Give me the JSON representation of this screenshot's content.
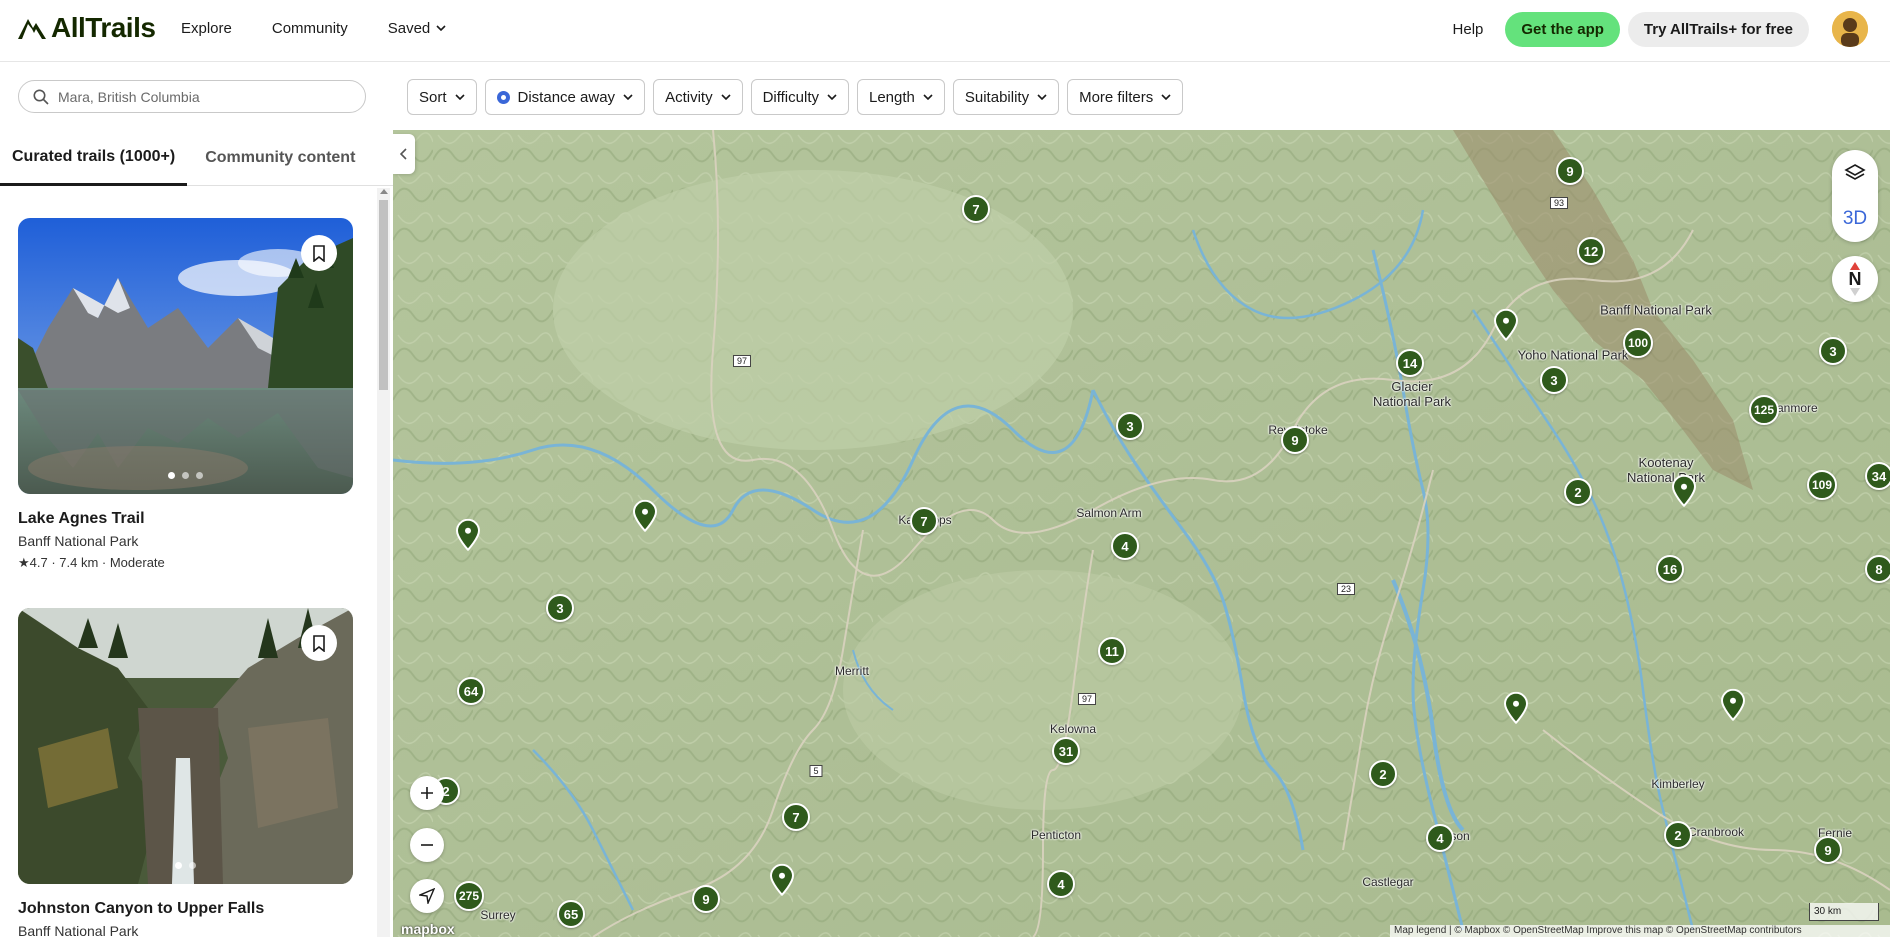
{
  "header": {
    "logo_text": "AllTrails",
    "nav": [
      "Explore",
      "Community",
      "Saved"
    ],
    "help": "Help",
    "get_app": "Get the app",
    "try_plus": "Try AllTrails+ for free"
  },
  "search": {
    "placeholder": "Mara, British Columbia"
  },
  "filters": [
    "Sort",
    "Distance away",
    "Activity",
    "Difficulty",
    "Length",
    "Suitability",
    "More filters"
  ],
  "tabs": {
    "curated": "Curated trails (1000+)",
    "community": "Community content"
  },
  "trails": [
    {
      "title": "Lake Agnes Trail",
      "park": "Banff National Park",
      "rating": "4.7",
      "meta": " · 7.4 km · Moderate",
      "star": "★"
    },
    {
      "title": "Johnston Canyon to Upper Falls",
      "park": "Banff National Park"
    }
  ],
  "map": {
    "btn_3d": "3D",
    "compass": "N",
    "scale": "30 km",
    "mapbox": "mapbox",
    "attribution": "Map legend | © Mapbox © OpenStreetMap  Improve this map © OpenStreetMap contributors",
    "places": {
      "kamloops": "Kamloops",
      "salmon_arm": "Salmon Arm",
      "revelstoke": "Revelstoke",
      "merritt": "Merritt",
      "kelowna": "Kelowna",
      "penticton": "Penticton",
      "castlegar": "Castlegar",
      "kimberley": "Kimberley",
      "cranbrook": "Cranbrook",
      "fernie": "Fernie",
      "surrey": "Surrey",
      "nelson": "Nelson",
      "canmore": "Canmore"
    },
    "parks": {
      "banff": "Banff National Park",
      "yoho": "Yoho National Park",
      "glacier": "Glacier\nNational Park",
      "kootenay": "Kootenay\nNational Park"
    },
    "highways": {
      "h97a": "97",
      "h93": "93",
      "h23": "23",
      "h97b": "97",
      "h5": "5"
    },
    "clusters": [
      "9",
      "12",
      "7",
      "14",
      "100",
      "3",
      "3",
      "125",
      "3",
      "9",
      "2",
      "109",
      "34",
      "7",
      "4",
      "16",
      "8",
      "3",
      "11",
      "64",
      "31",
      "2",
      "2",
      "4",
      "2",
      "9",
      "7",
      "4",
      "275",
      "65",
      "9"
    ]
  }
}
